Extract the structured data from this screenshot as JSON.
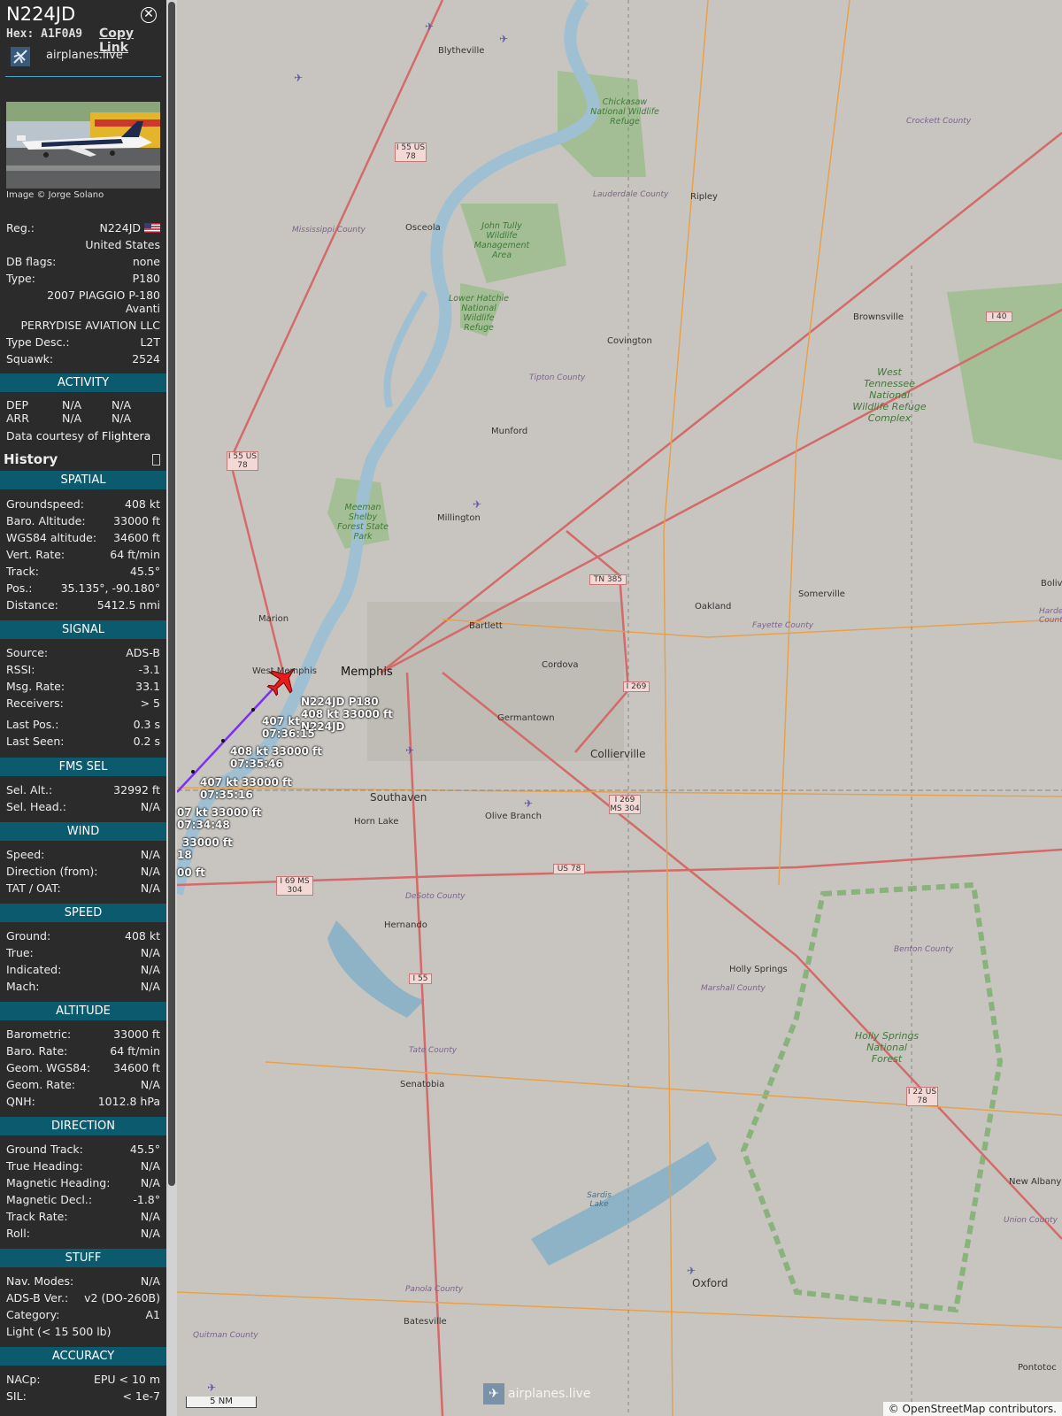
{
  "aircraft": {
    "callsign": "N224JD",
    "hex_label": "Hex:",
    "hex": "A1F0A9",
    "copy_link": "Copy Link",
    "site_name": "airplanes.live",
    "photo_credit": "Image © Jorge Solano"
  },
  "details": [
    {
      "key": "Reg.:",
      "value": "N224JD"
    },
    {
      "key": "",
      "value": "United States"
    },
    {
      "key": "DB flags:",
      "value": "none"
    },
    {
      "key": "Type:",
      "value": "P180"
    },
    {
      "key": "",
      "value": "2007 PIAGGIO P-180"
    },
    {
      "key": "",
      "value": "Avanti"
    },
    {
      "key": "",
      "value": "PERRYDISE AVIATION LLC"
    },
    {
      "key": "Type Desc.:",
      "value": "L2T"
    },
    {
      "key": "Squawk:",
      "value": "2524"
    }
  ],
  "activity": {
    "title": "ACTIVITY",
    "dep_label": "DEP",
    "dep_a": "N/A",
    "dep_b": "N/A",
    "arr_label": "ARR",
    "arr_a": "N/A",
    "arr_b": "N/A",
    "courtesy": "Data courtesy of",
    "courtesy_brand": "Flightera"
  },
  "history_label": "History",
  "sections": [
    {
      "title": "SPATIAL",
      "rows": [
        {
          "key": "Groundspeed:",
          "value": "408 kt"
        },
        {
          "key": "Baro. Altitude:",
          "value": "33000 ft"
        },
        {
          "key": "WGS84 altitude:",
          "value": "34600 ft"
        },
        {
          "key": "Vert. Rate:",
          "value": "64 ft/min"
        },
        {
          "key": "Track:",
          "value": "45.5°"
        },
        {
          "key": "Pos.:",
          "value": "35.135°, -90.180°"
        },
        {
          "key": "Distance:",
          "value": "5412.5 nmi"
        }
      ]
    },
    {
      "title": "SIGNAL",
      "rows": [
        {
          "key": "Source:",
          "value": "ADS-B"
        },
        {
          "key": "RSSI:",
          "value": "-3.1"
        },
        {
          "key": "Msg. Rate:",
          "value": "33.1"
        },
        {
          "key": "Receivers:",
          "value": "> 5"
        },
        {
          "key": "Last Pos.:",
          "value": "0.3 s"
        },
        {
          "key": "Last Seen:",
          "value": "0.2 s"
        }
      ]
    },
    {
      "title": "FMS SEL",
      "rows": [
        {
          "key": "Sel. Alt.:",
          "value": "32992 ft"
        },
        {
          "key": "Sel. Head.:",
          "value": "N/A"
        }
      ]
    },
    {
      "title": "WIND",
      "rows": [
        {
          "key": "Speed:",
          "value": "N/A"
        },
        {
          "key": "Direction (from):",
          "value": "N/A"
        },
        {
          "key": "TAT / OAT:",
          "value": "N/A"
        }
      ]
    },
    {
      "title": "SPEED",
      "rows": [
        {
          "key": "Ground:",
          "value": "408 kt"
        },
        {
          "key": "True:",
          "value": "N/A"
        },
        {
          "key": "Indicated:",
          "value": "N/A"
        },
        {
          "key": "Mach:",
          "value": "N/A"
        }
      ]
    },
    {
      "title": "ALTITUDE",
      "rows": [
        {
          "key": "Barometric:",
          "value": "33000 ft"
        },
        {
          "key": "Baro. Rate:",
          "value": "64 ft/min"
        },
        {
          "key": "Geom. WGS84:",
          "value": "34600 ft"
        },
        {
          "key": "Geom. Rate:",
          "value": "N/A"
        },
        {
          "key": "QNH:",
          "value": "1012.8 hPa"
        }
      ]
    },
    {
      "title": "DIRECTION",
      "rows": [
        {
          "key": "Ground Track:",
          "value": "45.5°"
        },
        {
          "key": "True Heading:",
          "value": "N/A"
        },
        {
          "key": "Magnetic Heading:",
          "value": "N/A"
        },
        {
          "key": "Magnetic Decl.:",
          "value": "-1.8°"
        },
        {
          "key": "Track Rate:",
          "value": "N/A"
        },
        {
          "key": "Roll:",
          "value": "N/A"
        }
      ]
    },
    {
      "title": "STUFF",
      "rows": [
        {
          "key": "Nav. Modes:",
          "value": "N/A"
        },
        {
          "key": "ADS-B Ver.:",
          "value": "v2 (DO-260B)"
        },
        {
          "key": "Category:",
          "value": "A1"
        },
        {
          "key": "Light (< 15 500 lb)",
          "value": ""
        }
      ]
    },
    {
      "title": "ACCURACY",
      "rows": [
        {
          "key": "NACp:",
          "value": "EPU < 10 m"
        },
        {
          "key": "SIL:",
          "value": "< 1e-7"
        }
      ]
    }
  ],
  "map": {
    "places": [
      "Blytheville",
      "Osceola",
      "Ripley",
      "Covington",
      "Brownsville",
      "Munford",
      "Millington",
      "Marion",
      "West Memphis",
      "Memphis",
      "Bartlett",
      "Cordova",
      "Germantown",
      "Collierville",
      "Southaven",
      "Horn Lake",
      "Olive Branch",
      "Oakland",
      "Somerville",
      "Hernando",
      "Holly Springs",
      "Senatobia",
      "Batesville",
      "Oxford",
      "New Albany",
      "Pontotoc",
      "Bolivar"
    ],
    "counties": [
      "Mississippi County",
      "Lauderdale County",
      "Crockett County",
      "Tipton County",
      "Fayette County",
      "DeSoto County",
      "Marshall County",
      "Benton County",
      "Tate County",
      "Panola County",
      "Quitman County",
      "Union County",
      "Hardeman County"
    ],
    "refuges": [
      "Chickasaw National Wildlife Refuge",
      "John Tully Wildlife Management Area",
      "Lower Hatchie National Wildlife Refuge",
      "West Tennessee National Wildlife Refuge Complex",
      "Meeman Shelby Forest State Park",
      "Holly Springs National Forest",
      "Sardis Lake"
    ],
    "shields": [
      "I 55 US 78",
      "I 55 US 78",
      "I 40",
      "TN 385",
      "I 269",
      "I 269 MS 304",
      "US 78",
      "I 69 MS 304",
      "I 55",
      "I 22 US 78"
    ],
    "plane_label": [
      "N224JD P180",
      "408 kt 33000 ft",
      "N224JD"
    ],
    "track_labels": [
      [
        "407 kt",
        "07:36:15"
      ],
      [
        "408 kt 33000 ft",
        "07:35:46"
      ],
      [
        "407 kt 33000 ft",
        "07:35:16"
      ],
      [
        "07 kt 33000 ft",
        "07:34:48"
      ],
      [
        "33000 ft",
        "18"
      ],
      [
        "00 ft",
        ""
      ]
    ],
    "scale": "5 NM",
    "attribution": "© OpenStreetMap contributors.",
    "watermark": "airplanes.live",
    "colors": {
      "track": "#7b2ff7",
      "plane": "#e81c1c",
      "road_major": "#d46a6a",
      "road_secondary": "#e6a14a",
      "water": "#9fc0d3",
      "forest": "#7fae70"
    }
  }
}
